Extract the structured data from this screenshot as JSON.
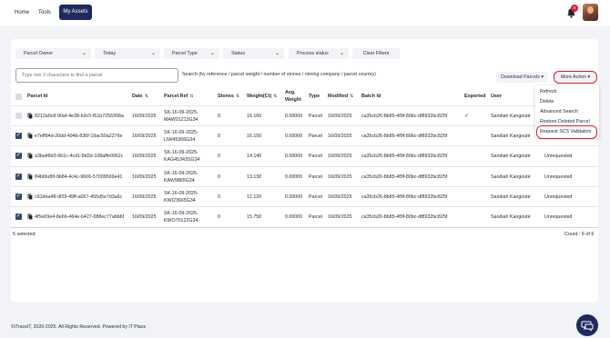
{
  "nav": {
    "home": "Home",
    "tools": "Tools",
    "my_assets": "My Assets"
  },
  "notifications": {
    "count": "0",
    "icon": "bell-icon"
  },
  "filters": {
    "parcel_owner": "Parcel Owner",
    "date": "Today",
    "parcel_type": "Parcel Type",
    "status": "Status",
    "process_status": "Process status",
    "clear": "Clear Filters"
  },
  "search": {
    "placeholder": "Type min 3 characters to find a parcel",
    "hint": "Search (by reference / parcel weight / number of stones / mining company / parcel country)"
  },
  "actions": {
    "download": "Download Parcels ▾",
    "more": "More Action ▾"
  },
  "menu": {
    "items": [
      "Refresh",
      "Delete",
      "Advanced Search",
      "Restore Deleted Parcel",
      "Request SCS Validation"
    ]
  },
  "table": {
    "headers": {
      "parcel_id": "Parcel Id",
      "date": "Date",
      "parcel_ref": "Parcel Ref",
      "stones": "Stones",
      "weight": "Weight(Ct)",
      "avg_weight_1": "Avg.",
      "avg_weight_2": "Weight",
      "type": "Type",
      "modified": "Modified",
      "batch_id": "Batch Id",
      "exported": "Exported",
      "user": "User",
      "sort_glyph": "⇅"
    },
    "rows": [
      {
        "parcel_id": "8212a0c8-90af-4e38-b3c5-f61b7255958a",
        "date": "16/09/2025",
        "ref_1": "SK-16-09-2025-",
        "ref_2": "MAW01213G34",
        "stones": "0",
        "weight": "16.160",
        "avg": "0.00000",
        "type": "Parcel",
        "modified": "16/09/2025",
        "batch": "ca35cb26-8b85-4f9f-80bc-df8932bc825f",
        "exported": "✓",
        "user": "Sandiah Kangouté",
        "status": ""
      },
      {
        "parcel_id": "e7eff94d-20dd-494b-836f-19ac50a2276e",
        "date": "16/09/2025",
        "ref_1": "SK-16-09-2025-",
        "ref_2": "LIW45366G34",
        "stones": "0",
        "weight": "15.150",
        "avg": "0.00000",
        "type": "Parcel",
        "modified": "16/09/2025",
        "batch": "ca35cb26-8b85-4f9f-80bc-df8932bc825f",
        "exported": "",
        "user": "Sandiah Kangouté",
        "status": "Unrequested"
      },
      {
        "parcel_id": "a3ba48d3-6b1c-4cd1-8d2d-108affe0962c",
        "date": "16/09/2025",
        "ref_1": "SK-16-09-2025-",
        "ref_2": "KAG45343SG34",
        "stones": "0",
        "weight": "14.140",
        "avg": "0.00000",
        "type": "Parcel",
        "modified": "16/09/2025",
        "batch": "ca35cb26-8b85-4f9f-80bc-df8932bc825f",
        "exported": "",
        "user": "Sandiah Kangouté",
        "status": "Unrequested"
      },
      {
        "parcel_id": "84b6bd9f-9b84-4c4c-9606-57009569e41",
        "date": "16/09/2025",
        "ref_1": "SK-16-09-2025-",
        "ref_2": "KAW9865G34",
        "stones": "0",
        "weight": "13.130",
        "avg": "0.00000",
        "type": "Parcel",
        "modified": "16/09/2025",
        "batch": "ca35cb26-8b85-4f9f-80bc-df8932bc825f",
        "exported": "",
        "user": "Sandiah Kangouté",
        "status": "Unrequested"
      },
      {
        "parcel_id": "c91dea48-df29-49ff-a067-455d5e7d3a6c",
        "date": "16/09/2025",
        "ref_1": "SK-16-09-2025-",
        "ref_2": "KWI23665G34",
        "stones": "0",
        "weight": "12.120",
        "avg": "0.00000",
        "type": "Parcel",
        "modified": "16/09/2025",
        "batch": "ca35cb26-8b85-4f9f-80bc-df8932bc825f",
        "exported": "",
        "user": "Sandiah Kangouté",
        "status": "Unrequested"
      },
      {
        "parcel_id": "4f5e69e4-8e6b-464e-b427-088ec77abb6f",
        "date": "16/09/2025",
        "ref_1": "SK-16-09-2025-",
        "ref_2": "KWO70122G34",
        "stones": "0",
        "weight": "15.750",
        "avg": "0.00000",
        "type": "Parcel",
        "modified": "16/09/2025",
        "batch": "ca35cb26-8b85-4f9f-80bc-df8932bc825f",
        "exported": "",
        "user": "Sandiah Kangouté",
        "status": "Unrequested"
      }
    ],
    "selected": "5 selected",
    "count": "Count : 6 of 6"
  },
  "footer": {
    "copyright": "©iTraceiT, 2020-2025. All Rights Reserved. Powered by IT Place"
  },
  "colors": {
    "primary": "#1e2a5e",
    "highlight": "#d2202c",
    "badge": "#e11d2e"
  }
}
